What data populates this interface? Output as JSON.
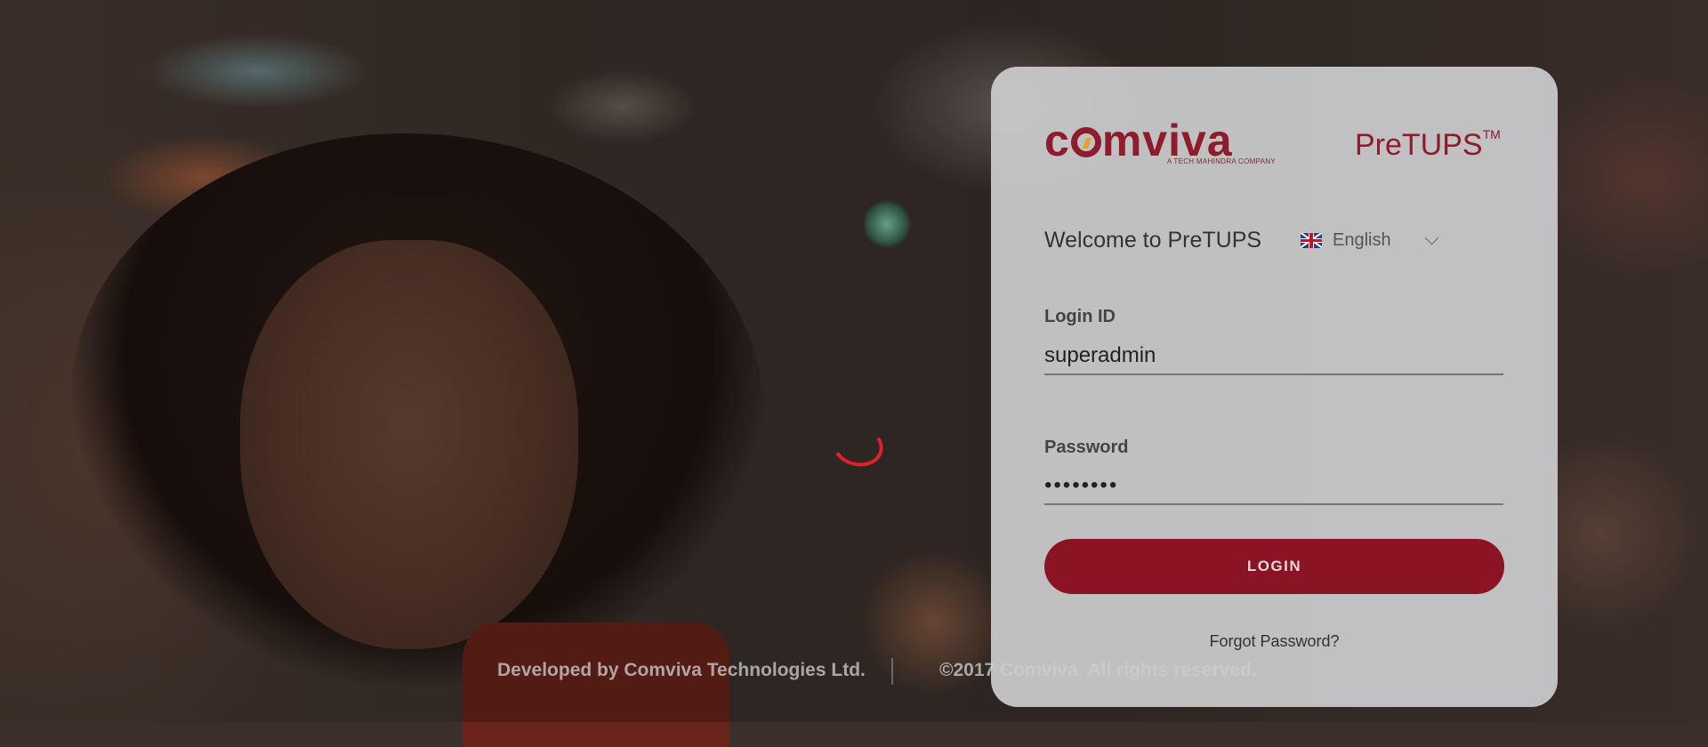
{
  "brand": {
    "company": "comviva",
    "company_tagline": "A TECH MAHINDRA COMPANY",
    "product": "PreTUPS",
    "product_mark": "TM",
    "brand_color": "#8e1c2a",
    "accent_color": "#e4a323"
  },
  "login": {
    "welcome": "Welcome to PreTUPS",
    "language": {
      "selected": "English",
      "flag_icon": "uk-flag-icon"
    },
    "login_id": {
      "label": "Login ID",
      "value": "superadmin"
    },
    "password": {
      "label": "Password",
      "value": "••••••••"
    },
    "login_button": "LOGIN",
    "forgot_password": "Forgot Password?"
  },
  "footer": {
    "developed_by": "Developed by Comviva Technologies Ltd.",
    "copyright": "©2017 Comviva. All rights reserved."
  }
}
